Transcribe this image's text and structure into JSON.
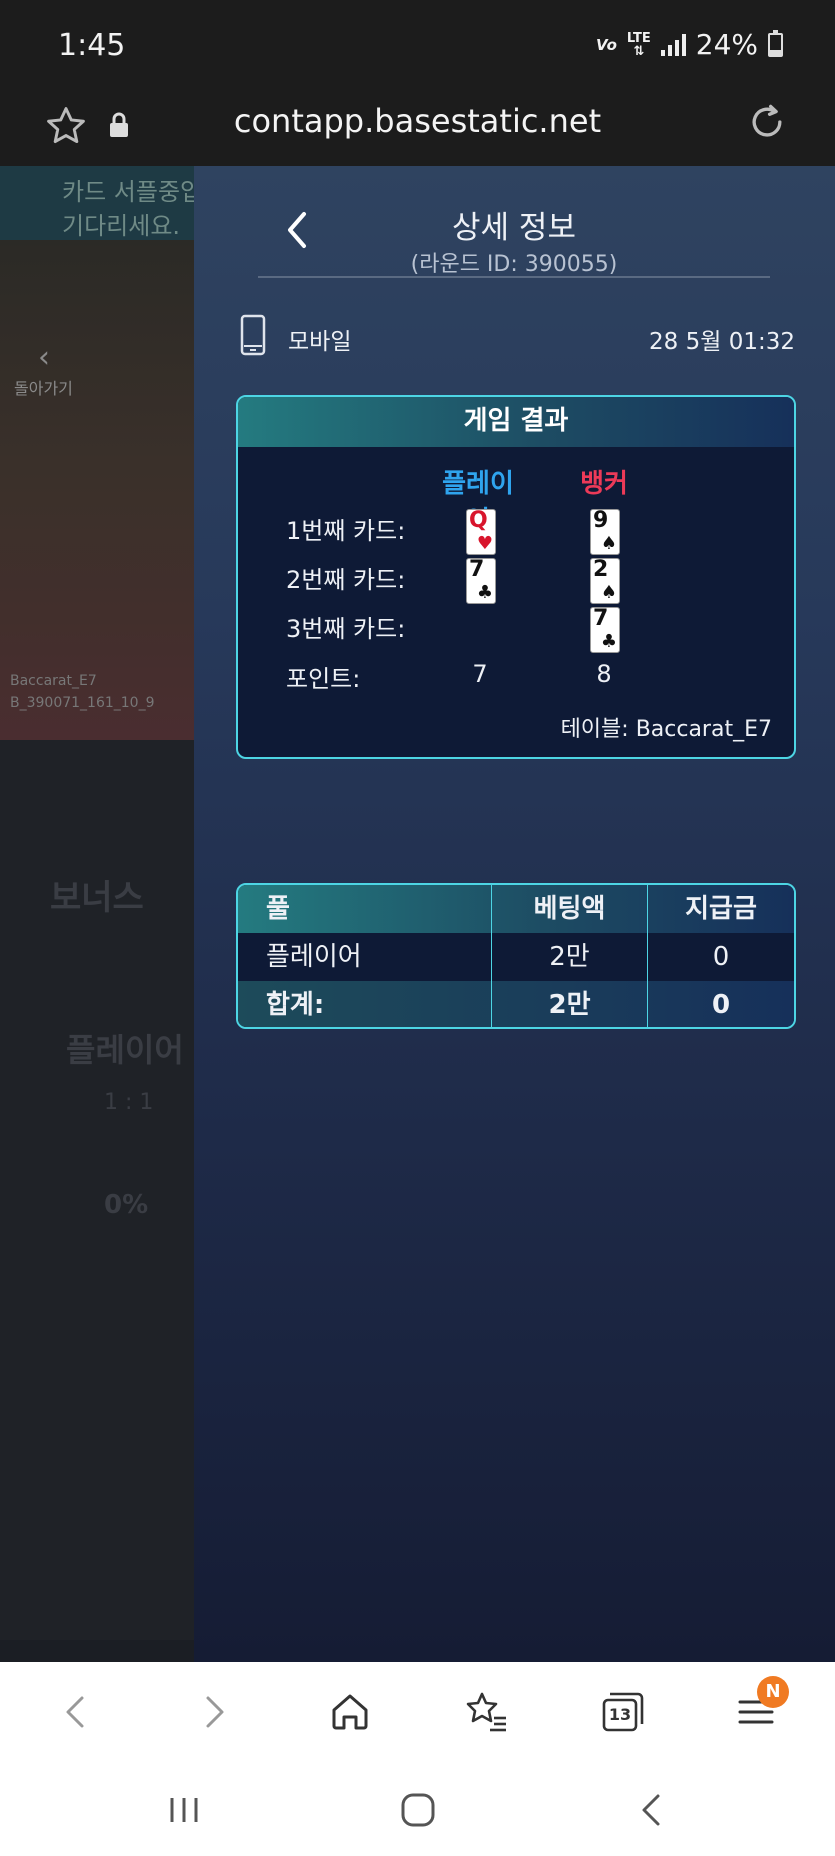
{
  "status_bar": {
    "time": "1:45",
    "volte": "Vo",
    "network": "LTE",
    "battery": "24%",
    "battery_level": 0.24
  },
  "browser": {
    "url": "contapp.basestatic.net",
    "tab_count": "13",
    "badge": "N",
    "badge_color": "#f07a22"
  },
  "background_page": {
    "notice_line1": "카드 서플중입",
    "notice_line2": "기다리세요.",
    "back_label": "돌아가기",
    "table_label_1": "Baccarat_E7",
    "table_label_2": "B_390071_161_10_9",
    "bonus": "보너스",
    "player": "플레이어",
    "ratio": "1 : 1",
    "percent": "0%"
  },
  "detail": {
    "title": "상세 정보",
    "round_id": "(라운드 ID: 390055)",
    "device": "모바일",
    "datetime": "28  5월 01:32"
  },
  "game_result": {
    "header": "게임 결과",
    "player_label": "플레이어",
    "banker_label": "뱅커",
    "row1_label": "1번째  카드:",
    "row2_label": "2번째 카드:",
    "row3_label": "3번째 카드:",
    "points_label": "포인트:",
    "player_cards": [
      {
        "rank": "Q",
        "suit": "♥",
        "color": "red"
      },
      {
        "rank": "7",
        "suit": "♣",
        "color": "black"
      }
    ],
    "banker_cards": [
      {
        "rank": "9",
        "suit": "♠",
        "color": "black"
      },
      {
        "rank": "2",
        "suit": "♠",
        "color": "black"
      },
      {
        "rank": "7",
        "suit": "♣",
        "color": "black"
      }
    ],
    "player_points": "7",
    "banker_points": "8",
    "table": "테이블: Baccarat_E7",
    "player_color": "#2fa4ee",
    "banker_color": "#ec3a58"
  },
  "bets": {
    "headers": [
      "풀",
      "베팅액",
      "지급금"
    ],
    "rows": [
      [
        "플레이어",
        "2만",
        "0"
      ]
    ],
    "total": [
      "합계:",
      "2만",
      "0"
    ]
  },
  "colors": {
    "accent_border": "#4dd5e4"
  }
}
